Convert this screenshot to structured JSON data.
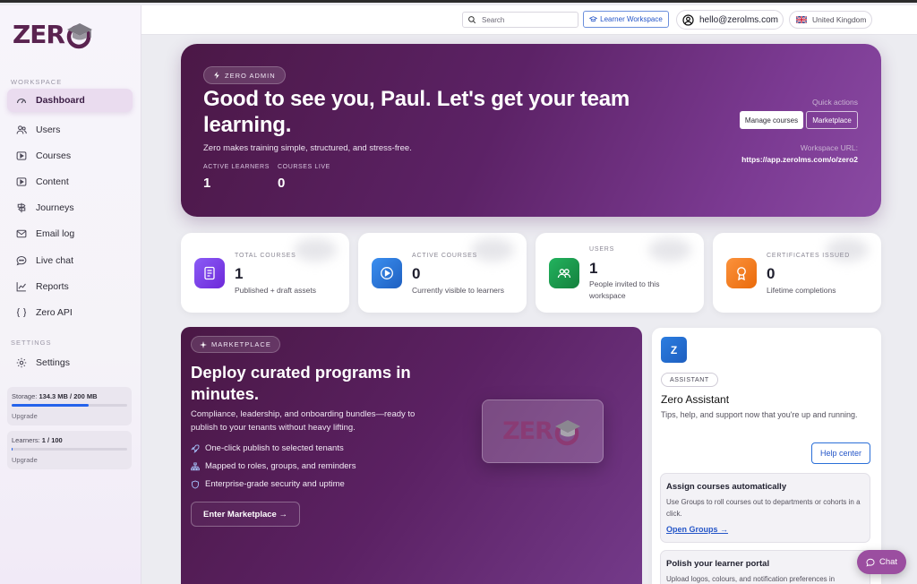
{
  "brand": {
    "logo_text": "ZER",
    "accent": "#5a2350"
  },
  "sidebar": {
    "workspace_label": "WORKSPACE",
    "items": [
      {
        "label": "Dashboard",
        "icon": "gauge-icon"
      },
      {
        "label": "Users",
        "icon": "users-icon"
      },
      {
        "label": "Courses",
        "icon": "play-square-icon"
      },
      {
        "label": "Content",
        "icon": "play-square-icon"
      },
      {
        "label": "Journeys",
        "icon": "signpost-icon"
      },
      {
        "label": "Email log",
        "icon": "mail-icon"
      },
      {
        "label": "Live chat",
        "icon": "chat-bubble-icon"
      },
      {
        "label": "Reports",
        "icon": "line-chart-icon"
      },
      {
        "label": "Zero API",
        "icon": "braces-icon"
      }
    ],
    "settings_label": "SETTINGS",
    "settings_item": "Settings",
    "storage": {
      "label": "Storage:",
      "value": "134.3 MB / 200 MB",
      "fraction": 0.67,
      "upgrade": "Upgrade"
    },
    "learners": {
      "label": "Learners:",
      "value": "1 / 100",
      "fraction": 0.01,
      "upgrade": "Upgrade"
    }
  },
  "topbar": {
    "search_placeholder": "Search",
    "learner_workspace": "Learner Workspace",
    "email": "hello@zerolms.com",
    "country": "United Kingdom"
  },
  "hero": {
    "badge": "ZERO ADMIN",
    "title": "Good to see you, Paul. Let's get your team learning.",
    "subtitle": "Zero makes training simple, structured, and stress-free.",
    "kpis": [
      {
        "label": "ACTIVE LEARNERS",
        "value": "1"
      },
      {
        "label": "COURSES LIVE",
        "value": "0"
      }
    ],
    "quick_actions_label": "Quick actions",
    "manage_courses": "Manage courses",
    "marketplace": "Marketplace",
    "workspace_url_label": "Workspace URL:",
    "workspace_url": "https://app.zerolms.com/o/zero2"
  },
  "stats": [
    {
      "label": "TOTAL COURSES",
      "value": "1",
      "desc": "Published + draft assets",
      "color": "#7c3aed"
    },
    {
      "label": "ACTIVE COURSES",
      "value": "0",
      "desc": "Currently visible to learners",
      "color": "#2b7de0"
    },
    {
      "label": "USERS",
      "value": "1",
      "desc": "People invited to this workspace",
      "color": "#16a34a"
    },
    {
      "label": "CERTIFICATES ISSUED",
      "value": "0",
      "desc": "Lifetime completions",
      "color": "#f07d0a"
    }
  ],
  "marketplace": {
    "badge": "MARKETPLACE",
    "title": "Deploy curated programs in minutes.",
    "subtitle": "Compliance, leadership, and onboarding bundles—ready to publish to your tenants without heavy lifting.",
    "features": [
      "One-click publish to selected tenants",
      "Mapped to roles, groups, and reminders",
      "Enterprise-grade security and uptime"
    ],
    "cta": "Enter Marketplace →"
  },
  "assistant": {
    "badge_letter": "Z",
    "tag": "ASSISTANT",
    "title": "Zero Assistant",
    "subtitle": "Tips, help, and support now that you're up and running.",
    "help_center": "Help center",
    "tips": [
      {
        "title": "Assign courses automatically",
        "desc": "Use Groups to roll courses out to departments or cohorts in a click.",
        "link": "Open Groups →"
      },
      {
        "title": "Polish your learner portal",
        "desc": "Upload logos, colours, and notification preferences in"
      }
    ]
  },
  "chat": {
    "label": "Chat"
  }
}
